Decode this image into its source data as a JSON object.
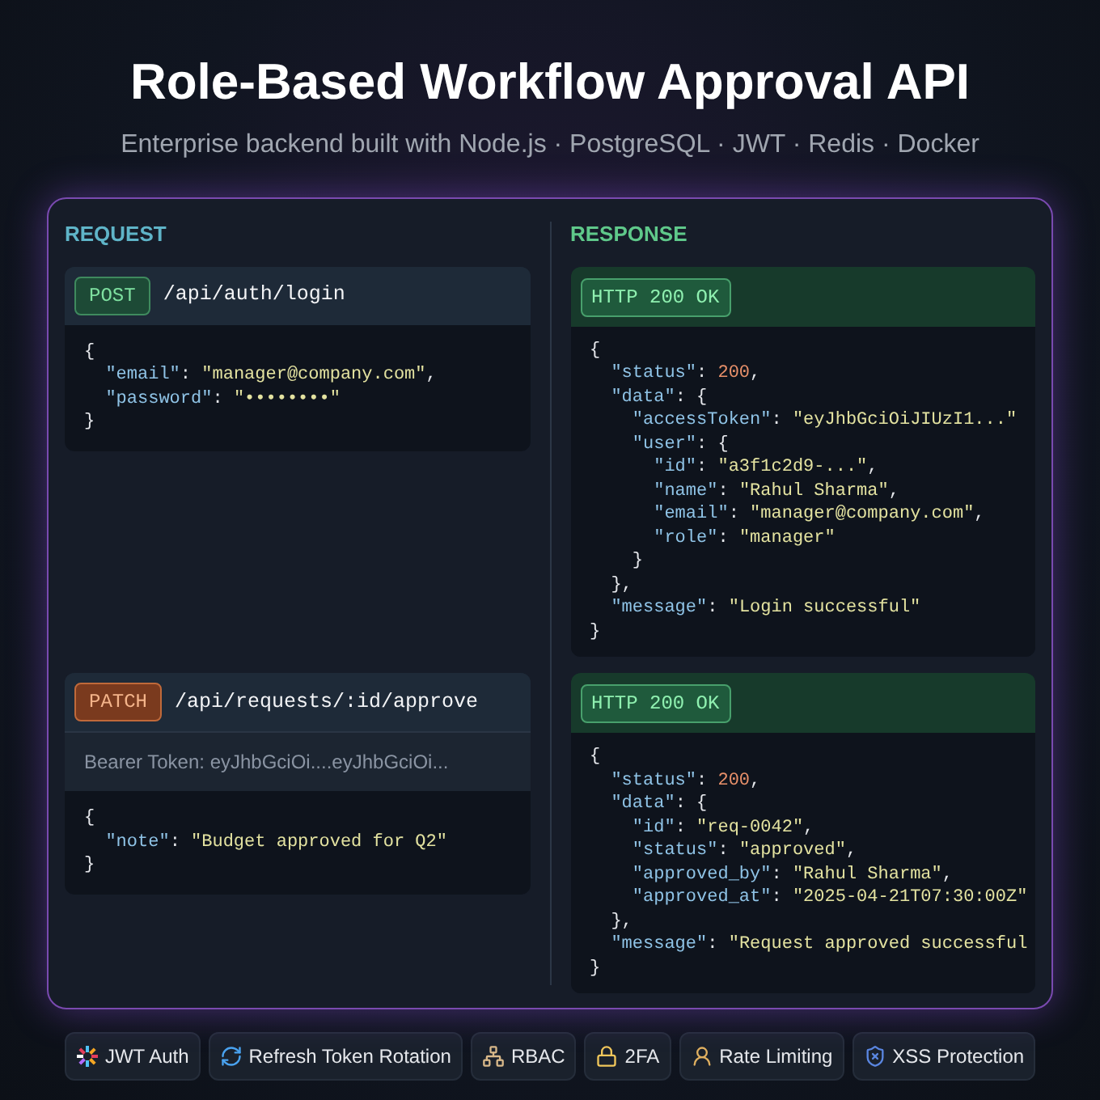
{
  "title": "Role-Based Workflow Approval API",
  "subtitle": "Enterprise backend built with Node.js · PostgreSQL · JWT · Redis · Docker",
  "request": {
    "heading": "REQUEST",
    "calls": [
      {
        "method": "POST",
        "kind": "post",
        "path": "/api/auth/login",
        "body": [
          "{",
          "  \"email\": \"manager@company.com\",",
          "  \"password\": \"••••••••\"",
          "}"
        ]
      },
      {
        "method": "PATCH",
        "kind": "patch",
        "path": "/api/requests/:id/approve",
        "auth": "Bearer Token: eyJhbGciOi....eyJhbGciOi...",
        "body": [
          "{",
          "  \"note\": \"Budget approved for Q2\"",
          "}"
        ]
      }
    ]
  },
  "response": {
    "heading": "RESPONSE",
    "results": [
      {
        "status": "HTTP 200 OK",
        "body": [
          "{",
          "  \"status\": 200,",
          "  \"data\": {",
          "    \"accessToken\": \"eyJhbGciOiJIUzI1...\"",
          "    \"user\": {",
          "      \"id\": \"a3f1c2d9-...\",",
          "      \"name\": \"Rahul Sharma\",",
          "      \"email\": \"manager@company.com\",",
          "      \"role\": \"manager\"",
          "    }",
          "  },",
          "  \"message\": \"Login successful\"",
          "}"
        ]
      },
      {
        "status": "HTTP 200 OK",
        "body": [
          "{",
          "  \"status\": 200,",
          "  \"data\": {",
          "    \"id\": \"req-0042\",",
          "    \"status\": \"approved\",",
          "    \"approved_by\": \"Rahul Sharma\",",
          "    \"approved_at\": \"2025-04-21T07:30:00Z\"",
          "  },",
          "  \"message\": \"Request approved successful",
          "}"
        ]
      }
    ]
  },
  "features": [
    {
      "label": "JWT Auth"
    },
    {
      "label": "Refresh Token Rotation"
    },
    {
      "label": "RBAC"
    },
    {
      "label": "2FA"
    },
    {
      "label": "Rate Limiting"
    },
    {
      "label": "XSS Protection"
    }
  ]
}
